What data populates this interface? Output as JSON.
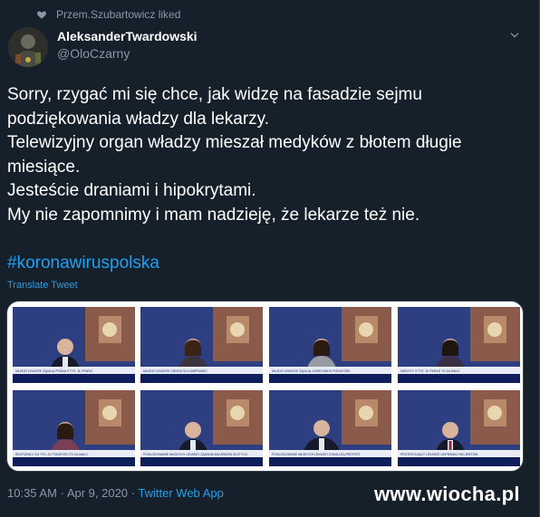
{
  "social_context": {
    "icon": "heart-icon",
    "text": "Przem.Szubartowicz liked"
  },
  "author": {
    "name": "AleksanderTwardowski",
    "handle": "@OloCzarny"
  },
  "tweet": {
    "lines": [
      "Sorry, rzygać mi się chce, jak widzę na fasadzie sejmu",
      "podziękowania władzy dla lekarzy.",
      "Telewizyjny organ władzy mieszał medyków z błotem długie",
      "miesiące.",
      "Jesteście draniami i hipokrytami.",
      "My nie zapomnimy i mam nadzieję, że lekarze też nie."
    ],
    "hashtag": "#koronawiruspolska",
    "translate_label": "Translate Tweet"
  },
  "media": {
    "captions": [
      "MŁODZI LEKARZE ŻĄDAJĄ PONAD 9 TYS. ZŁ PENSJI",
      "MŁODZI LEKARZE ODRZUCILI KOMPROMIS",
      "MŁODZI LEKARZE ŻĄDAJĄ OLBRZYMICH PODWYŻEK",
      "MEDYCY: 9 TYS. ZŁ PENSJI TO ZA MAŁO",
      "REZYDENCI: 9,6 TYS. ZŁ PODWYŻKI TO ZA MAŁO",
      "POGŁODOWANIE MŁODYCH LEKARZY ŻĄDANIA MILIARDÓW ZŁOTYCH",
      "POGŁODOWANIE MŁODYCH LEKARZY ESKALUJĄ PROTEST",
      "PROTESTUJĄCY LEKARZE ODPRAWILI PACJENTÓW"
    ]
  },
  "footer": {
    "time": "10:35 AM",
    "separator": "·",
    "date": "Apr 9, 2020",
    "source": "Twitter Web App"
  },
  "watermark": {
    "text": "www.wiocha.pl"
  },
  "colors": {
    "background": "#15202b",
    "accent": "#1da1f2",
    "muted": "#8899a6",
    "border": "#38444d"
  }
}
